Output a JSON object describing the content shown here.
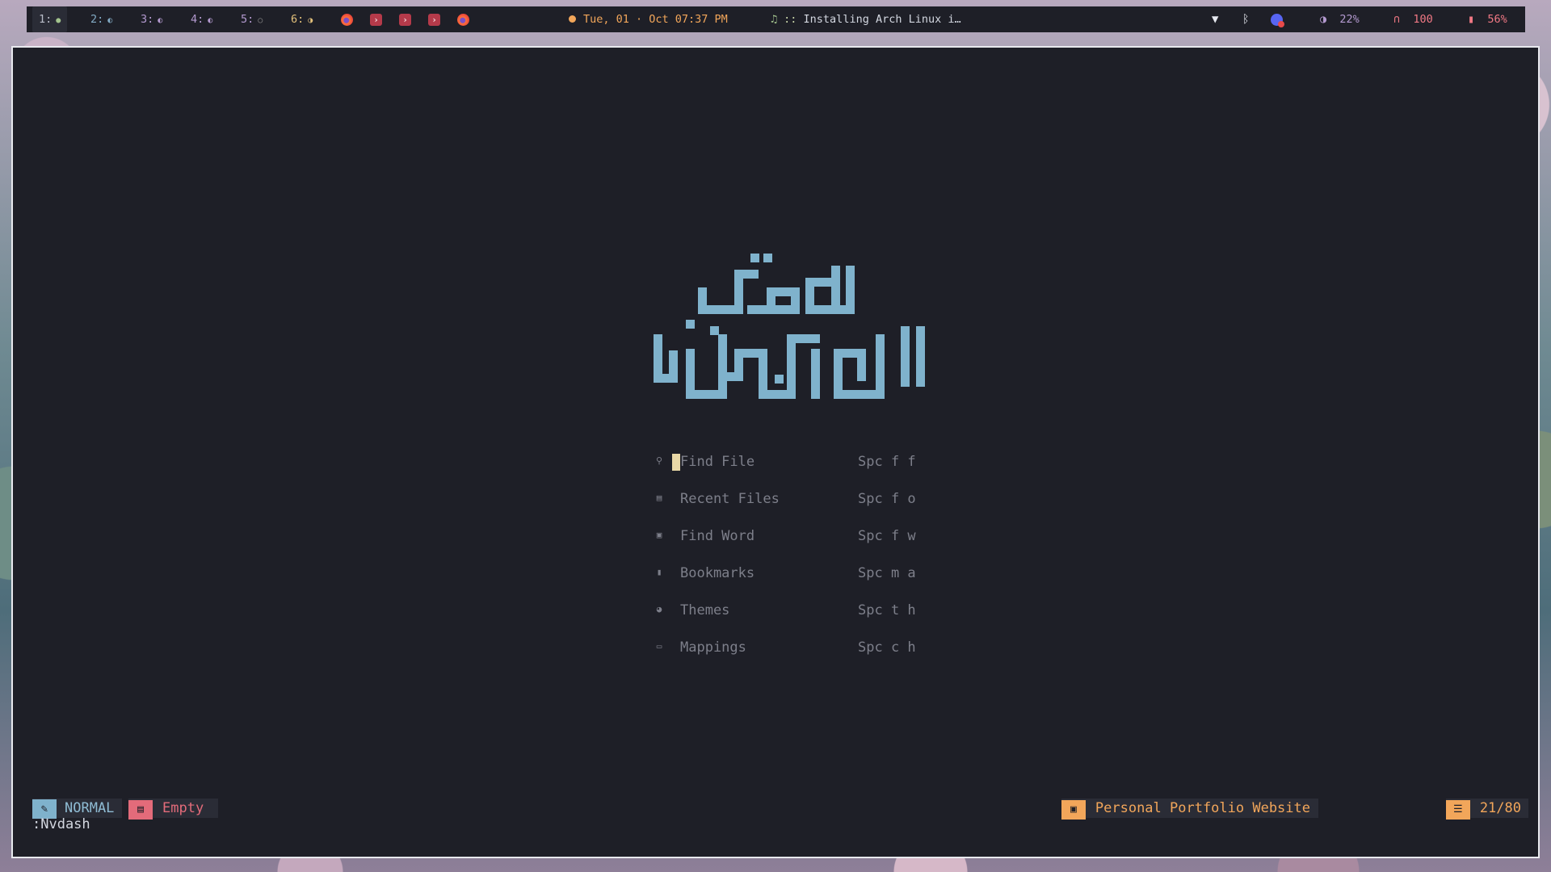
{
  "topbar": {
    "workspaces": [
      {
        "label": "1:",
        "glyph": "●",
        "active": true
      },
      {
        "label": "2:",
        "glyph": "◐",
        "active": false
      },
      {
        "label": "3:",
        "glyph": "◐",
        "active": false
      },
      {
        "label": "4:",
        "glyph": "◐",
        "active": false
      },
      {
        "label": "5:",
        "glyph": "○",
        "active": false
      },
      {
        "label": "6:",
        "glyph": "◑",
        "active": false
      }
    ],
    "apps": [
      "firefox-icon",
      "terminal-icon",
      "terminal-icon",
      "terminal-icon",
      "firefox-icon"
    ],
    "clock": "Tue, 01 · Oct  07:37 PM",
    "music_prefix": "::",
    "music_title": "Installing Arch Linux i…",
    "brightness": "22%",
    "volume": "100",
    "battery": "56%"
  },
  "dashboard": {
    "menu": [
      {
        "icon": "search-icon",
        "glyph": "⚲",
        "label": "Find File",
        "key": "Spc f f"
      },
      {
        "icon": "recent-files-icon",
        "glyph": "▤",
        "label": "Recent Files",
        "key": "Spc f o"
      },
      {
        "icon": "find-word-icon",
        "glyph": "▣",
        "label": "Find Word",
        "key": "Spc f w"
      },
      {
        "icon": "bookmark-icon",
        "glyph": "▮",
        "label": "Bookmarks",
        "key": "Spc m a"
      },
      {
        "icon": "palette-icon",
        "glyph": "◕",
        "label": "Themes",
        "key": "Spc t h"
      },
      {
        "icon": "keyboard-icon",
        "glyph": "▭",
        "label": "Mappings",
        "key": "Spc c h"
      }
    ]
  },
  "statusline": {
    "mode": "NORMAL",
    "file": "Empty",
    "cwd": "Personal Portfolio Website",
    "position": "21/80"
  },
  "cmdline": ":Nvdash",
  "colors": {
    "background": "#1e1f27",
    "logo": "#7fb2cc",
    "accent_orange": "#f2a65a",
    "accent_red": "#e36b7a"
  }
}
